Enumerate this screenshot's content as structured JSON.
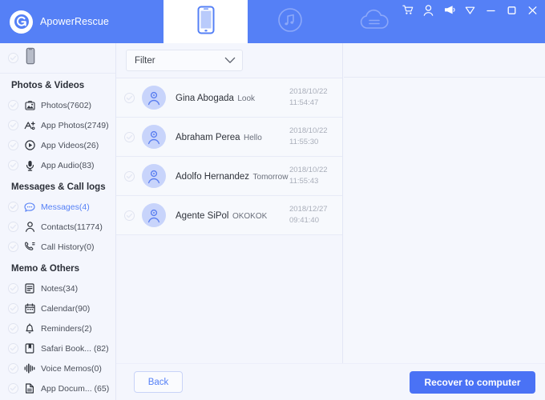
{
  "app": {
    "brand_name": "ApowerRescue",
    "logo_icon": "apower-logo-icon",
    "accent_color": "#5580f6",
    "button_color": "#4a72f5"
  },
  "header": {
    "tabs": [
      {
        "id": "device",
        "icon": "iphone-device-icon",
        "active": true
      },
      {
        "id": "itunes",
        "icon": "music-note-circle-icon",
        "active": false
      },
      {
        "id": "icloud",
        "icon": "cloud-icon",
        "active": false
      }
    ],
    "window_controls": [
      {
        "id": "cart",
        "icon": "shopping-cart-icon"
      },
      {
        "id": "account",
        "icon": "user-account-icon"
      },
      {
        "id": "announce",
        "icon": "megaphone-icon"
      },
      {
        "id": "menu",
        "icon": "chevron-down-triangle-icon"
      },
      {
        "id": "minimize",
        "icon": "minimize-icon"
      },
      {
        "id": "maximize",
        "icon": "maximize-icon"
      },
      {
        "id": "close",
        "icon": "close-icon"
      }
    ]
  },
  "sidebar": {
    "device": {
      "icon": "iphone-device-icon",
      "checked": true
    },
    "groups": [
      {
        "title": "Photos & Videos",
        "items": [
          {
            "label": "Photos(7602)",
            "icon": "photo-icon",
            "active": false
          },
          {
            "label": "App Photos(2749)",
            "icon": "app-photos-icon",
            "active": false
          },
          {
            "label": "App Videos(26)",
            "icon": "play-circle-icon",
            "active": false
          },
          {
            "label": "App Audio(83)",
            "icon": "microphone-icon",
            "active": false
          }
        ]
      },
      {
        "title": "Messages & Call logs",
        "items": [
          {
            "label": "Messages(4)",
            "icon": "message-bubble-icon",
            "active": true
          },
          {
            "label": "Contacts(11774)",
            "icon": "contact-person-icon",
            "active": false
          },
          {
            "label": "Call History(0)",
            "icon": "phone-call-icon",
            "active": false
          }
        ]
      },
      {
        "title": "Memo & Others",
        "items": [
          {
            "label": "Notes(34)",
            "icon": "notes-icon",
            "active": false
          },
          {
            "label": "Calendar(90)",
            "icon": "calendar-icon",
            "active": false
          },
          {
            "label": "Reminders(2)",
            "icon": "bell-icon",
            "active": false
          },
          {
            "label": "Safari Book... (82)",
            "icon": "bookmark-icon",
            "active": false
          },
          {
            "label": "Voice Memos(0)",
            "icon": "waveform-icon",
            "active": false
          },
          {
            "label": "App Docum... (65)",
            "icon": "document-icon",
            "active": false
          }
        ]
      }
    ]
  },
  "list_pane": {
    "filter": {
      "label": "Filter",
      "icon": "chevron-down-icon"
    },
    "messages": [
      {
        "name": "Gina Abogada",
        "preview": "Look",
        "date": "2018/10/22",
        "time": "11:54:47",
        "avatar_icon": "person-avatar-icon",
        "checked": true
      },
      {
        "name": "Abraham Perea",
        "preview": "Hello",
        "date": "2018/10/22",
        "time": "11:55:30",
        "avatar_icon": "person-avatar-icon",
        "checked": true
      },
      {
        "name": "Adolfo Hernandez",
        "preview": "Tomorrow",
        "date": "2018/10/22",
        "time": "11:55:43",
        "avatar_icon": "person-avatar-icon",
        "checked": true
      },
      {
        "name": "Agente SiPol",
        "preview": "OKOKOK",
        "date": "2018/12/27",
        "time": "09:41:40",
        "avatar_icon": "person-avatar-icon",
        "checked": true
      }
    ]
  },
  "footer": {
    "back_label": "Back",
    "recover_label": "Recover to computer"
  }
}
